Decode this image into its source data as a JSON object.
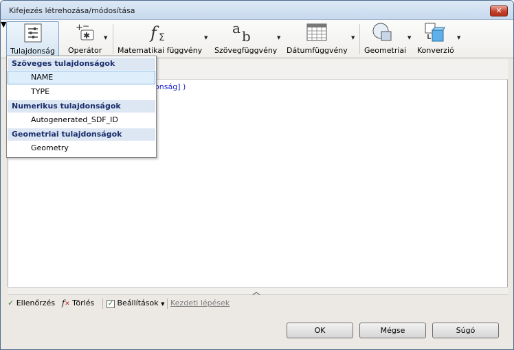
{
  "window": {
    "title": "Kifejezés létrehozása/módosítása",
    "close_label": "✕"
  },
  "ribbon": {
    "tulajdonsag": "Tulajdonság",
    "operator": "Operátor",
    "matematikai": "Matematikai függvény",
    "szoveg": "Szövegfüggvény",
    "datum": "Dátumfüggvény",
    "geometriai": "Geometriai",
    "konverzio": "Konverzió"
  },
  "editor": {
    "expression_tail": "lonság] )"
  },
  "dropdown": {
    "groups": [
      {
        "label": "Szöveges tulajdonságok",
        "items": [
          "NAME",
          "TYPE"
        ]
      },
      {
        "label": "Numerikus tulajdonságok",
        "items": [
          "Autogenerated_SDF_ID"
        ]
      },
      {
        "label": "Geometriai tulajdonságok",
        "items": [
          "Geometry"
        ]
      }
    ],
    "selected": "NAME"
  },
  "status": {
    "ellenorzes": "Ellenőrzés",
    "torles": "Törlés",
    "beallitasok": "Beállítások",
    "kezdeti": "Kezdeti lépések"
  },
  "buttons": {
    "ok": "OK",
    "megse": "Mégse",
    "sugo": "Súgó"
  },
  "colors": {
    "accent": "#79b1e2",
    "group_bg": "#dde7f4",
    "expression_keyword": "#1b23c8"
  }
}
